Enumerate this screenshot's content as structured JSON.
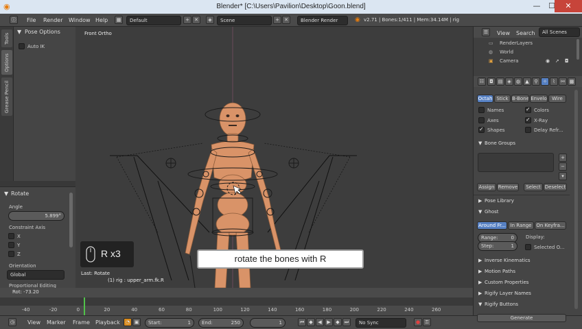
{
  "window": {
    "title": "Blender* [C:\\Users\\Pavilion\\Desktop\\Goon.blend]",
    "minimize": "—",
    "maximize": "☐",
    "close": "✕"
  },
  "menubar": {
    "menus": [
      "File",
      "Render",
      "Window",
      "Help"
    ],
    "screen_layout": "Default",
    "scene": "Scene",
    "render_engine": "Blender Render",
    "stats": "v2.71 | Bones:1/411 | Mem:34.14M | rig"
  },
  "left_tabs": [
    "Tools",
    "Options",
    "Grease Pencil"
  ],
  "tool_shelf": {
    "panel_title": "Pose Options",
    "auto_ik_label": "Auto IK"
  },
  "redo_panel": {
    "title": "Rotate",
    "angle_label": "Angle",
    "angle_value": "5.899°",
    "constraint_label": "Constraint Axis",
    "axes": [
      "X",
      "Y",
      "Z"
    ],
    "orientation_label": "Orientation",
    "orientation_value": "Global",
    "proportional_label": "Proportional Editing"
  },
  "viewport": {
    "view_label": "Front Ortho",
    "last_op": "Last: Rotate",
    "object_info": "(1) rig : upper_arm.fk.R",
    "rot_readout": "Rot: -73.20"
  },
  "overlay": {
    "caption": "rotate the bones with R",
    "keycast": "R x3"
  },
  "outliner": {
    "view_menu": "View",
    "search_menu": "Search",
    "filter": "All Scenes",
    "items": [
      "RenderLayers",
      "World",
      "Camera"
    ]
  },
  "properties": {
    "display_modes": [
      "Octah",
      "Stick",
      "B-Bone",
      "Envelo",
      "Wire"
    ],
    "display_options": [
      {
        "label": "Names",
        "checked": false
      },
      {
        "label": "Colors",
        "checked": true
      },
      {
        "label": "Axes",
        "checked": false
      },
      {
        "label": "X-Ray",
        "checked": true
      },
      {
        "label": "Shapes",
        "checked": true
      },
      {
        "label": "Delay Refr...",
        "checked": false
      }
    ],
    "bone_groups_title": "Bone Groups",
    "bone_group_buttons": [
      "Assign",
      "Remove",
      "Select",
      "Deselect"
    ],
    "pose_library": "Pose Library",
    "ghost_title": "Ghost",
    "ghost_modes": [
      "Around Fr...",
      "In Range",
      "On Keyfra..."
    ],
    "range_label": "Range:",
    "range_value": "0",
    "step_label": "Step:",
    "step_value": "1",
    "display_label": "Display:",
    "selected_only": "Selected O...",
    "sections": [
      "Inverse Kinematics",
      "Motion Paths",
      "Custom Properties",
      "Rigify Layer Names",
      "Rigify Buttons"
    ],
    "generate": "Generate"
  },
  "timeline": {
    "ruler": [
      "-40",
      "-20",
      "0",
      "20",
      "40",
      "60",
      "80",
      "100",
      "120",
      "140",
      "160",
      "180",
      "200",
      "220",
      "240",
      "260"
    ],
    "menus": [
      "View",
      "Marker",
      "Frame",
      "Playback"
    ],
    "start_label": "Start:",
    "start_value": "1",
    "end_label": "End:",
    "end_value": "250",
    "current_frame": "1",
    "sync": "No Sync"
  },
  "colors": {
    "accent": "#5680c2",
    "skin": "#d99368",
    "playhead": "#52c24a",
    "close": "#c7443a"
  }
}
